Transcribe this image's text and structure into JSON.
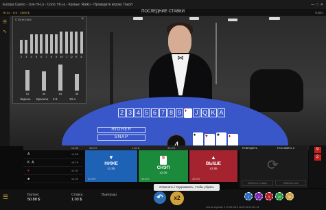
{
  "window": {
    "title": "Europa Casino - Live Hi-Lo - Соло: Hi-Lo - Крупье: Ratko - Проведите игроку ТоксИ",
    "controls": [
      "—",
      "□",
      "✕"
    ]
  },
  "topbar": {
    "left_label": "Hi-Lo · 0.5 - 1500 $",
    "center_title": "ПОСЛЕДНИЕ СТАВКИ",
    "dealer_name": "Ratko"
  },
  "stats": {
    "header": "Статистика",
    "close": "×",
    "top_bars": [
      {
        "label": "2",
        "value": 20
      },
      {
        "label": "3",
        "value": 20
      },
      {
        "label": "4",
        "value": 28
      },
      {
        "label": "5",
        "value": 28
      },
      {
        "label": "6",
        "value": 28
      },
      {
        "label": "7",
        "value": 28
      },
      {
        "label": "8",
        "value": 28
      },
      {
        "label": "9",
        "value": 28
      },
      {
        "label": "10",
        "value": 32
      },
      {
        "label": "J",
        "value": 32
      },
      {
        "label": "Q",
        "value": 32
      },
      {
        "label": "K",
        "value": 32
      },
      {
        "label": "A",
        "value": 32
      }
    ],
    "bottom_groups": [
      {
        "label": "Черное",
        "value": "51",
        "height": 30
      },
      {
        "label": "Красное",
        "value": "49",
        "height": 28
      },
      {
        "label": "2-9",
        "value": "64",
        "height": 38
      },
      {
        "label": "10-A",
        "value": "36",
        "height": 24
      }
    ]
  },
  "table": {
    "rank_strip": [
      "2",
      "3",
      "4",
      "5",
      "6",
      "7",
      "8",
      "9"
    ],
    "rank_strip_right": [
      "J",
      "Q",
      "K",
      "A"
    ],
    "higher_label": "HIGHER",
    "snap_label": "SNAP",
    "counter": "4"
  },
  "history": [
    {
      "rank": "A",
      "suit": "",
      "odds": "x1.55"
    },
    {
      "rank": "K",
      "suit": "A",
      "odds": "x5.76"
    },
    {
      "rank": "",
      "suit": "♥",
      "odds": "x1.92"
    },
    {
      "rank": "",
      "suit": "♣",
      "odds": "x1.92"
    }
  ],
  "bet_options": [
    {
      "pct": "33.3%",
      "label": "НИЖЕ",
      "odds": "x1.55",
      "color": "#1e62b6",
      "icon": "▼"
    },
    {
      "pct": "55.6%",
      "label": "СНЭП",
      "odds": "x2.06",
      "color": "#1b8a3b",
      "icon": "9"
    },
    {
      "pct": "33.3%",
      "label": "ВЫШЕ",
      "odds": "x2.86",
      "color": "#a5232f",
      "icon": "▲"
    }
  ],
  "header_values": [
    "38.9%",
    "1,65 $",
    "33.3%",
    "x1.55"
  ],
  "right_panel": {
    "repeat": "Повторить",
    "double": "Поставить x",
    "redo": "Заново",
    "clear": "Забрать ставку",
    "take": "Забрать все"
  },
  "side_counter": [
    "9",
    "2"
  ],
  "bottom": {
    "balance_label": "Баланс",
    "balance_value": "50.88 $",
    "bet_label": "Ставка",
    "bet_value": "1.03 $",
    "win_label": "Выигрыш",
    "win_value": "",
    "undo": "↶",
    "double": "x2",
    "chips": [
      "1",
      "2",
      "5",
      "10",
      "50"
    ],
    "chip_colors": [
      "#2a6fc0",
      "#7a2ab3",
      "#b51f2f",
      "#2c9c45",
      "#d2a23a"
    ]
  },
  "tooltip": "Отменить / Удерживать, чтобы убрать",
  "footer": "Кол-во игроков: 1   29.08.2019 16:23:16  ID:121.31"
}
